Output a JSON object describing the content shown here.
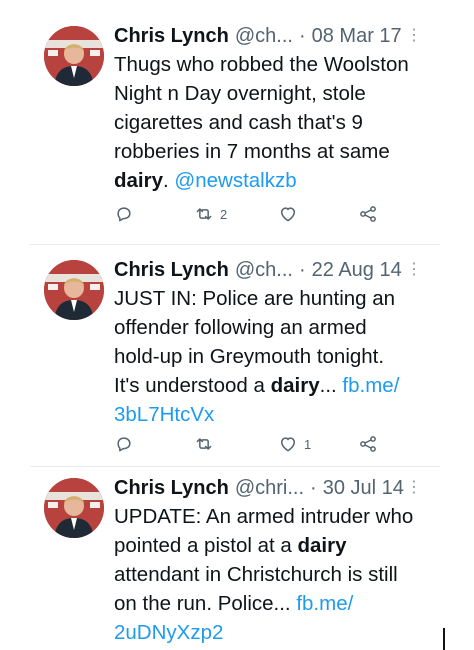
{
  "tweets": [
    {
      "name": "Chris Lynch",
      "handle": "@ch...",
      "separator": "·",
      "date": "08 Mar 17",
      "more_icon": "more-vertical-icon",
      "lines": [
        [
          {
            "t": "Thugs who robbed the Woolston"
          }
        ],
        [
          {
            "t": "Night n Day overnight, stole"
          }
        ],
        [
          {
            "t": "cigarettes and cash that's 9"
          }
        ],
        [
          {
            "t": "robberies in 7 months at same"
          }
        ],
        [
          {
            "t": "dairy",
            "s": "b"
          },
          {
            "t": ". "
          },
          {
            "t": "@newstalkzb",
            "s": "link"
          }
        ]
      ],
      "reply_count": "",
      "retweet_count": "2",
      "like_count": ""
    },
    {
      "name": "Chris Lynch",
      "handle": "@ch...",
      "separator": "·",
      "date": "22 Aug 14",
      "more_icon": "more-vertical-icon",
      "lines": [
        [
          {
            "t": "JUST IN: Police are hunting an"
          }
        ],
        [
          {
            "t": "offender following an armed"
          }
        ],
        [
          {
            "t": "hold-up in Greymouth tonight."
          }
        ],
        [
          {
            "t": "It's understood a "
          },
          {
            "t": "dairy",
            "s": "b"
          },
          {
            "t": "... "
          },
          {
            "t": "fb.me/",
            "s": "link"
          }
        ],
        [
          {
            "t": "3bL7HtcVx",
            "s": "link"
          }
        ]
      ],
      "reply_count": "",
      "retweet_count": "",
      "like_count": "1"
    },
    {
      "name": "Chris Lynch",
      "handle": "@chri...",
      "separator": "·",
      "date": "30 Jul 14",
      "more_icon": "more-vertical-icon",
      "lines": [
        [
          {
            "t": "UPDATE: An armed intruder who"
          }
        ],
        [
          {
            "t": "pointed a pistol at a "
          },
          {
            "t": "dairy",
            "s": "b"
          }
        ],
        [
          {
            "t": "attendant in Christchurch is still"
          }
        ],
        [
          {
            "t": "on the run. Police... "
          },
          {
            "t": "fb.me/",
            "s": "link"
          }
        ],
        [
          {
            "t": "2uDNyXzp2",
            "s": "link"
          }
        ]
      ]
    }
  ],
  "colors": {
    "text": "#0f1419",
    "secondary": "#536471",
    "link": "#1d9bf0",
    "divider": "#e6ecf0",
    "avatar_bg": "#b8433e"
  }
}
